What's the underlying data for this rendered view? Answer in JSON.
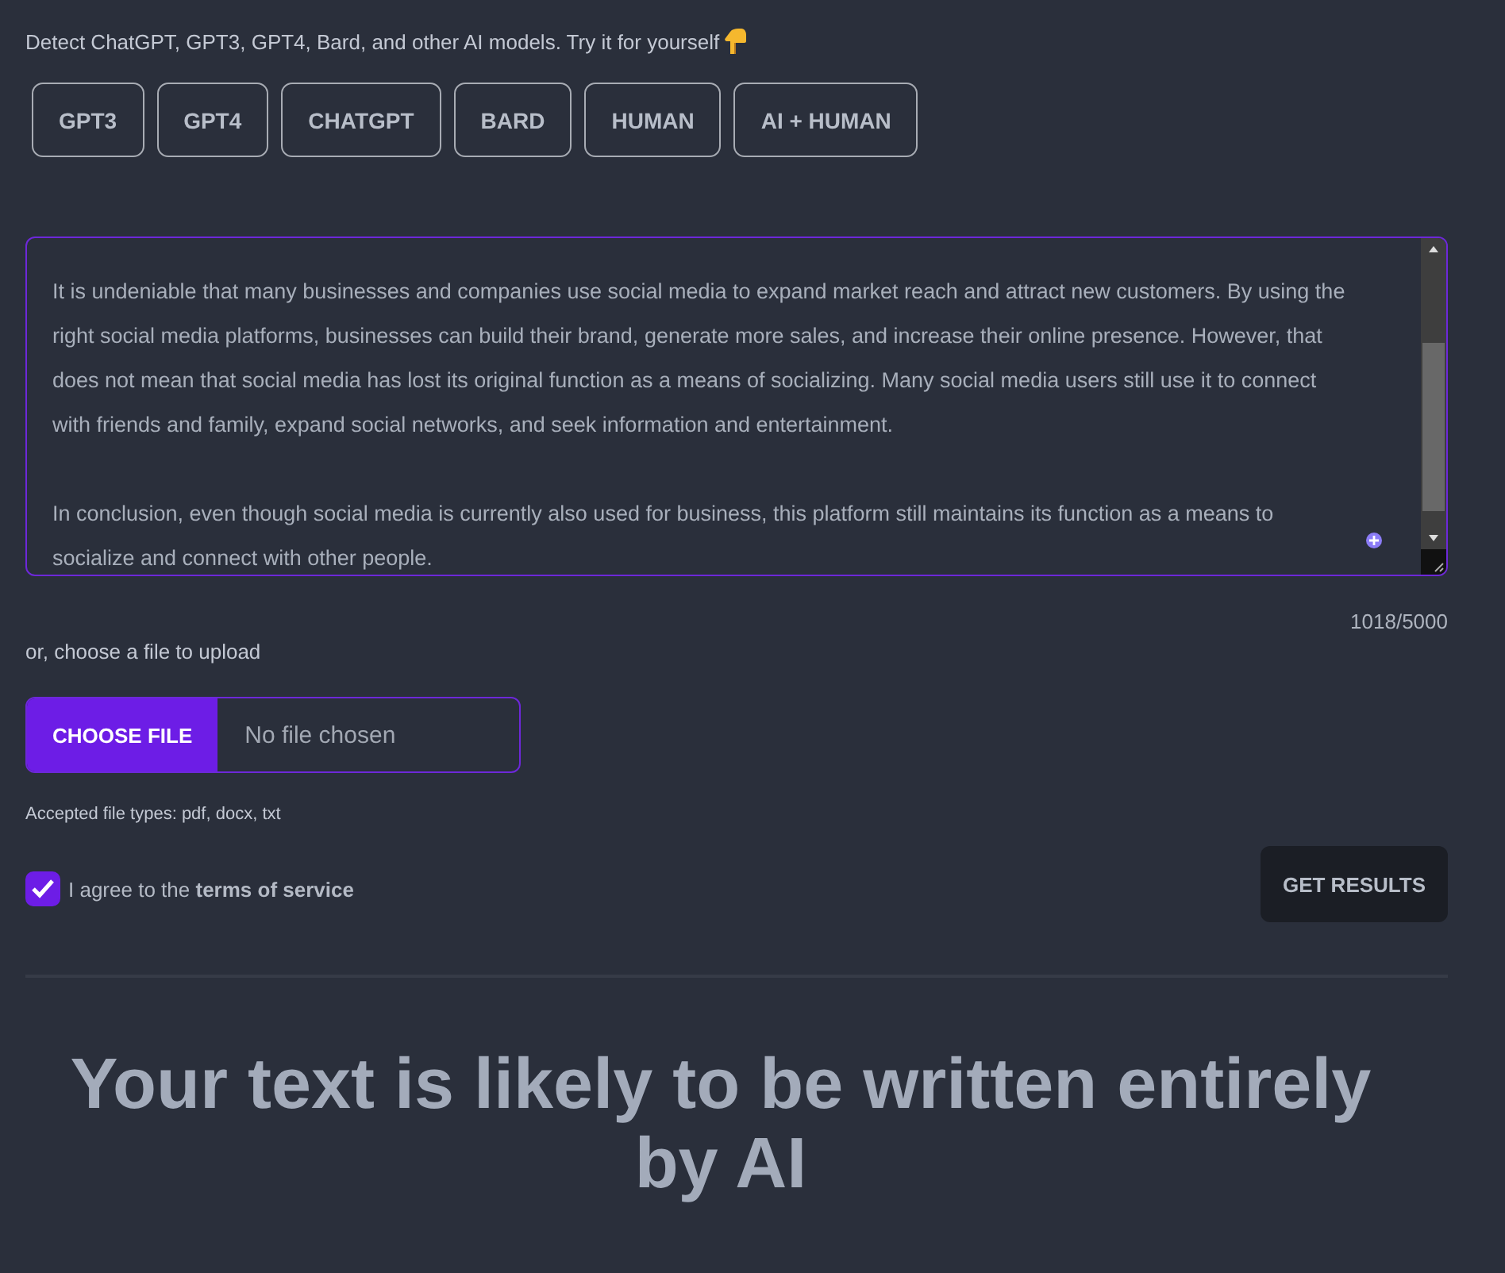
{
  "intro": "Detect ChatGPT, GPT3, GPT4, Bard, and other AI models. Try it for yourself",
  "models": [
    {
      "label": "GPT3"
    },
    {
      "label": "GPT4"
    },
    {
      "label": "CHATGPT"
    },
    {
      "label": "BARD"
    },
    {
      "label": "HUMAN"
    },
    {
      "label": "AI + HUMAN"
    }
  ],
  "text_input": {
    "paragraphs": [
      "It is undeniable that many businesses and companies use social media to expand market reach and attract new customers. By using the right social media platforms, businesses can build their brand, generate more sales, and increase their online presence. However, that does not mean that social media has lost its original function as a means of socializing. Many social media users still use it to connect with friends and family, expand social networks, and seek information and entertainment.",
      "In conclusion, even though social media is currently also used for business, this platform still maintains its function as a means to socialize and connect with other people."
    ],
    "counter": "1018/5000"
  },
  "upload": {
    "label": "or, choose a file to upload",
    "button": "CHOOSE FILE",
    "status": "No file chosen",
    "hint": "Accepted file types: pdf, docx, txt"
  },
  "agree": {
    "checked": true,
    "label": "I agree to the **terms of service**"
  },
  "submit": "GET RESULTS",
  "result": "Your text is likely to be written entirely by AI"
}
